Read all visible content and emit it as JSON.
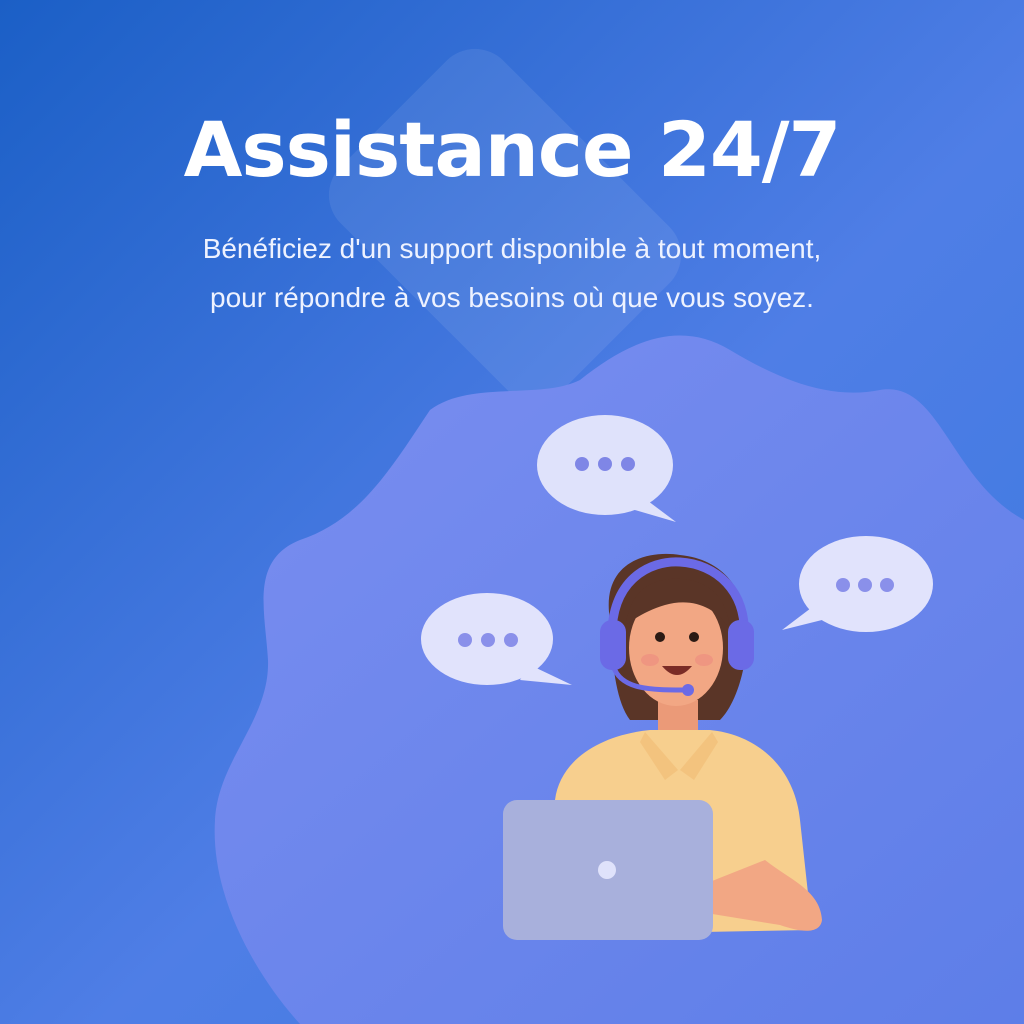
{
  "headline": "Assistance 24/7",
  "description": "Bénéficiez d'un support disponible à tout moment, pour répondre à vos besoins où que vous soyez.",
  "illustration": "support-agent-with-headset-and-laptop",
  "colors": {
    "background_start": "#1d62c8",
    "background_end": "#5c84e8",
    "blob": "#6f86ec",
    "bubble": "#dde0fb",
    "bubble_dots": "#7f86e6",
    "shirt": "#f7cf8e",
    "skin": "#f2a784",
    "hair": "#5a3527",
    "headset": "#6b6ae6",
    "laptop": "#a8b0dc",
    "text": "#ffffff"
  }
}
